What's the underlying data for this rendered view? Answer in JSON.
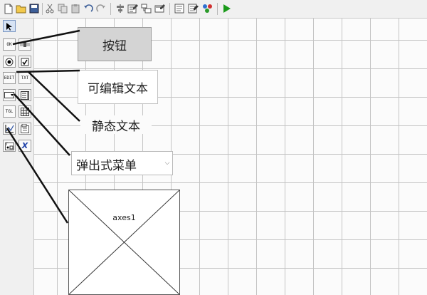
{
  "toolbar": {
    "items": [
      "new-file-icon",
      "open-folder-icon",
      "save-icon",
      "cut-icon",
      "copy-icon",
      "paste-icon",
      "undo-icon",
      "redo-icon",
      "align-objects-icon",
      "menu-editor-icon",
      "tab-order-editor-icon",
      "toolbar-editor-icon",
      "m-file-editor-icon",
      "property-inspector-icon",
      "object-browser-icon",
      "run-figure-icon"
    ],
    "run_color": "#1a9a1a"
  },
  "palette": {
    "tools": [
      {
        "name": "select-arrow-icon",
        "label": "",
        "selected": true
      },
      {
        "name": "push-button-tool-icon",
        "label": "OK"
      },
      {
        "name": "slider-tool-icon",
        "label": ""
      },
      {
        "name": "radio-button-tool-icon",
        "label": ""
      },
      {
        "name": "checkbox-tool-icon",
        "label": ""
      },
      {
        "name": "edit-text-tool-icon",
        "label": "EDIT"
      },
      {
        "name": "static-text-tool-icon",
        "label": "TXT"
      },
      {
        "name": "popup-menu-tool-icon",
        "label": ""
      },
      {
        "name": "listbox-tool-icon",
        "label": ""
      },
      {
        "name": "toggle-button-tool-icon",
        "label": "TGL"
      },
      {
        "name": "table-tool-icon",
        "label": ""
      },
      {
        "name": "axes-tool-icon",
        "label": ""
      },
      {
        "name": "panel-tool-icon",
        "label": ""
      },
      {
        "name": "button-group-tool-icon",
        "label": ""
      },
      {
        "name": "activex-control-tool-icon",
        "label": "X"
      }
    ]
  },
  "canvas": {
    "push_button": {
      "label": "按钮"
    },
    "edit_text": {
      "text": "可编辑文本"
    },
    "static_text": {
      "text": "静态文本"
    },
    "popup_menu": {
      "value": "弹出式菜单"
    },
    "axes": {
      "label": "axes1"
    }
  }
}
